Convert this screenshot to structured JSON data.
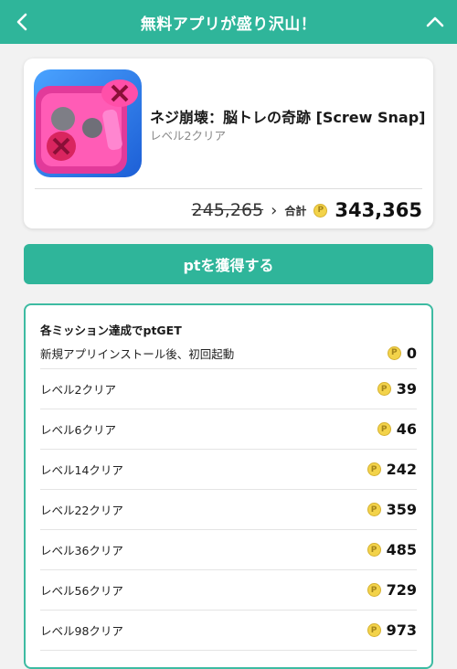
{
  "header": {
    "title": "無料アプリが盛り沢山！",
    "back_icon": "chevron-left-icon",
    "collapse_icon": "chevron-up-icon",
    "background": "#2fb59a"
  },
  "app": {
    "name": "ネジ崩壊：脳トレの奇跡 [Screw Snap]",
    "subtitle": "レベル2クリア",
    "old_points": "245,265",
    "total_label": "合計",
    "total_points": "343,365"
  },
  "action": {
    "label": "ptを獲得する"
  },
  "missions": {
    "heading": "各ミッション達成でptGET",
    "items": [
      {
        "label": "新規アプリインストール後、初回起動",
        "points": "0"
      },
      {
        "label": "レベル2クリア",
        "points": "39"
      },
      {
        "label": "レベル6クリア",
        "points": "46"
      },
      {
        "label": "レベル14クリア",
        "points": "242"
      },
      {
        "label": "レベル22クリア",
        "points": "359"
      },
      {
        "label": "レベル36クリア",
        "points": "485"
      },
      {
        "label": "レベル56クリア",
        "points": "729"
      },
      {
        "label": "レベル98クリア",
        "points": "973"
      }
    ]
  },
  "coin_symbol": "P",
  "colors": {
    "accent": "#2fb59a",
    "coin": "#f3d34a"
  }
}
